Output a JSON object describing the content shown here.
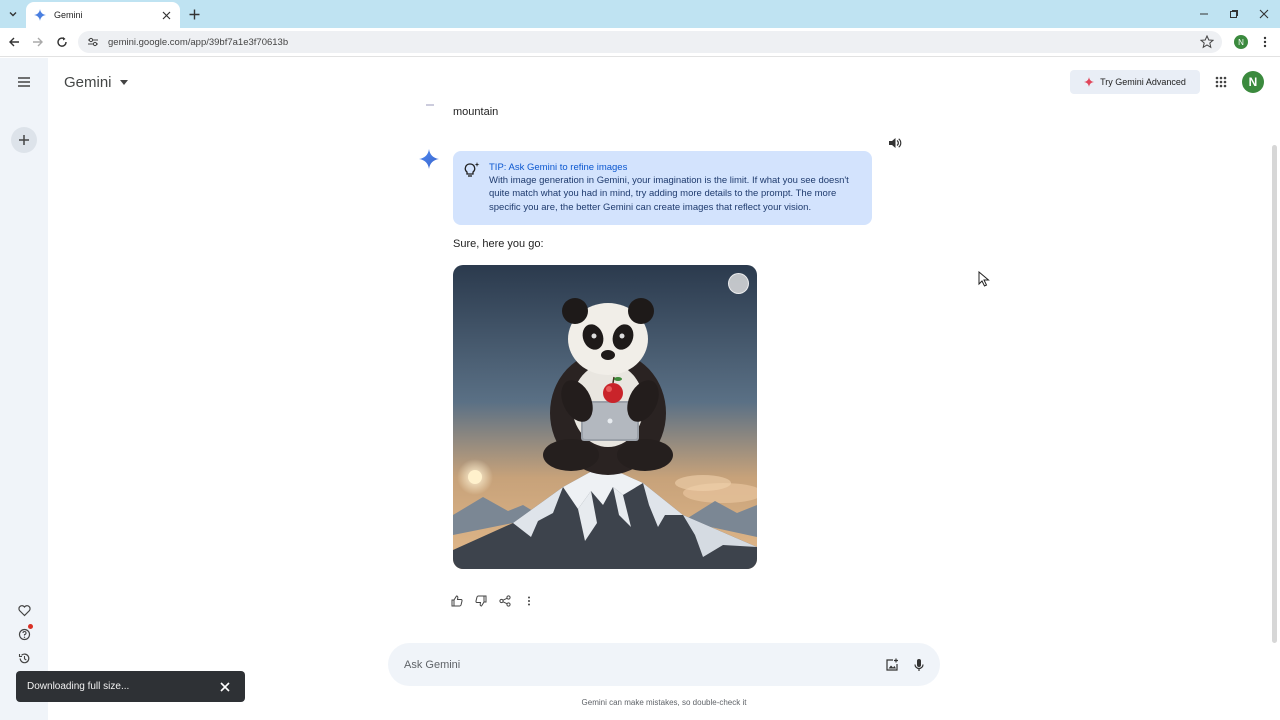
{
  "browser": {
    "tab_title": "Gemini",
    "url": "gemini.google.com/app/39bf7a1e3f70613b",
    "profile_initial": "N"
  },
  "app": {
    "title": "Gemini",
    "try_advanced_label": "Try Gemini Advanced",
    "avatar_initial": "N"
  },
  "conversation": {
    "user_prompt": "mountain",
    "tip": {
      "title": "TIP: Ask Gemini to refine images",
      "body": "With image generation in Gemini, your imagination is the limit. If what you see doesn't quite match what you had in mind, try adding more details to the prompt. The more specific you are, the better Gemini can create images that reflect your vision."
    },
    "reply": "Sure, here you go:"
  },
  "input": {
    "placeholder": "Ask Gemini"
  },
  "footer": {
    "disclaimer": "Gemini can make mistakes, so double-check it"
  },
  "toast": {
    "text": "Downloading full size..."
  },
  "colors": {
    "accent": "#0b57d0",
    "tip_bg": "#d3e3fd",
    "rail_bg": "#f0f4f9",
    "tabstrip_bg": "#bfe3f2"
  }
}
